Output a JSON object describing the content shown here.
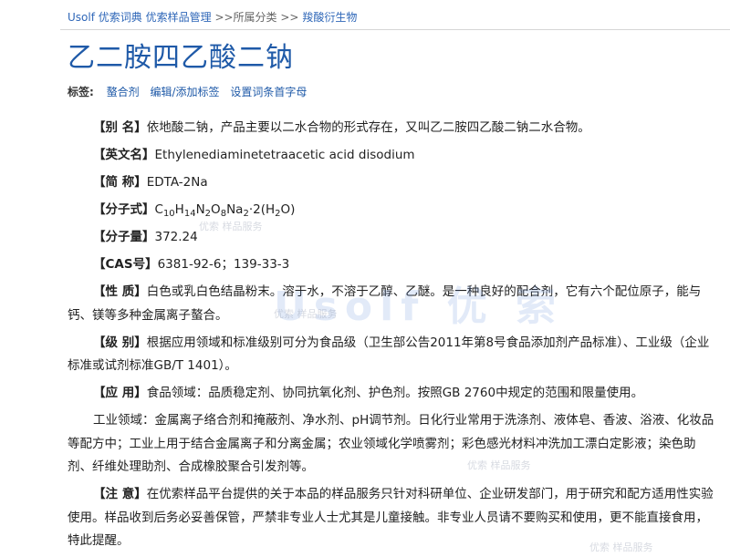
{
  "breadcrumb": {
    "site": "Usolf 优索词典",
    "section": "优索样品管理",
    "category_prefix": ">>所属分类 >>",
    "category": "羧酸衍生物"
  },
  "title": "乙二胺四乙酸二钠",
  "tags": {
    "label": "标签:",
    "items": [
      "螯合剂",
      "编辑/添加标签",
      "设置词条首字母"
    ]
  },
  "fields": {
    "alias": {
      "label": "【别  名】",
      "value": "依地酸二钠，产品主要以二水合物的形式存在，又叫乙二胺四乙酸二钠二水合物。"
    },
    "english": {
      "label": "【英文名】",
      "value": "Ethylenediaminetetraacetic acid disodium"
    },
    "abbr": {
      "label": "【简  称】",
      "value": "EDTA-2Na"
    },
    "formula": {
      "label": "【分子式】",
      "parts": [
        "C",
        "10",
        "H",
        "14",
        "N",
        "2",
        "O",
        "8",
        "Na",
        "2",
        "·2(H",
        "2",
        "O)"
      ]
    },
    "mw": {
      "label": "【分子量】",
      "value": "372.24"
    },
    "cas": {
      "label": "【CAS号】",
      "value": "6381-92-6；139-33-3"
    },
    "property": {
      "label": "【性  质】",
      "value": "白色或乳白色结晶粉末。溶于水，不溶于乙醇、乙醚。是一种良好的配合剂，它有六个配位原子，能与钙、镁等多种金属离子螯合。"
    },
    "grade": {
      "label": "【级  别】",
      "value": "根据应用领域和标准级别可分为食品级（卫生部公告2011年第8号食品添加剂产品标准）、工业级（企业标准或试剂标准GB/T 1401）。"
    },
    "use": {
      "label": "【应  用】",
      "value": "食品领域：品质稳定剂、协同抗氧化剂、护色剂。按照GB 2760中规定的范围和限量使用。"
    },
    "industry": {
      "value": "工业领域：金属离子络合剂和掩蔽剂、净水剂、pH调节剂。日化行业常用于洗涤剂、液体皂、香波、浴液、化妆品等配方中；工业上用于结合金属离子和分离金属；农业领域化学喷雾剂；彩色感光材料冲洗加工漂白定影液；染色助剂、纤维处理助剂、合成橡胶聚合引发剂等。"
    },
    "note": {
      "label": "【注  意】",
      "value": "在优索样品平台提供的关于本品的样品服务只针对科研单位、企业研发部门，用于研究和配方适用性实验使用。样品收到后务必妥善保管，严禁非专业人士尤其是儿童接触。非专业人员请不要购买和使用，更不能直接食用，特此提醒。"
    }
  },
  "watermark": {
    "main": "Usolf 优 索",
    "small": "优索 样品服务"
  }
}
